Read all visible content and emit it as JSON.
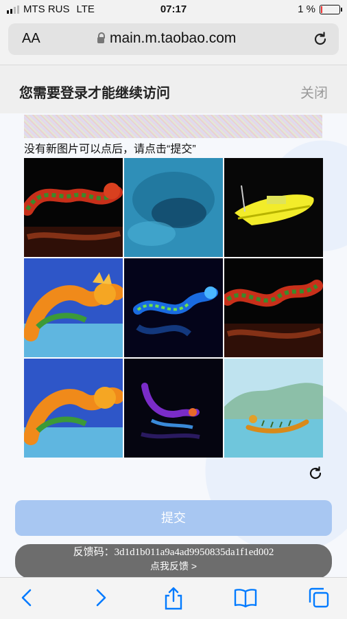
{
  "status": {
    "carrier": "MTS RUS",
    "network": "LTE",
    "time": "07:17",
    "battery": "1 %"
  },
  "browser": {
    "text_size_label": "AA",
    "url": "main.m.taobao.com"
  },
  "header": {
    "title": "您需要登录才能继续访问",
    "close_label": "关闭"
  },
  "captcha": {
    "hint": "没有新图片可以点后，请点击“提交”",
    "images": [
      {
        "subject": "dragon-red-green-dark"
      },
      {
        "subject": "blurry-blue-water-shape"
      },
      {
        "subject": "yellow-boat"
      },
      {
        "subject": "orange-dragon-water"
      },
      {
        "subject": "blue-dragon-reflection"
      },
      {
        "subject": "dragon-red-green-dark"
      },
      {
        "subject": "orange-dragon-water"
      },
      {
        "subject": "purple-dragon-dark"
      },
      {
        "subject": "dragon-boat-lake"
      }
    ],
    "submit_label": "提交"
  },
  "feedback": {
    "code_line": "反馈码：3d1d1b011a9a4ad9950835da1f1ed002",
    "link_label": "点我反馈 >"
  },
  "colors": {
    "accent": "#007aff",
    "submit_bg": "#a8c7f2"
  }
}
